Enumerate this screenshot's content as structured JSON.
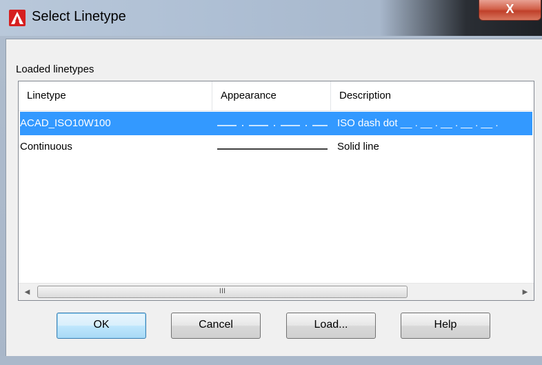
{
  "window": {
    "title": "Select Linetype",
    "close_label": "X",
    "app_icon": "autocad-icon",
    "accent_color": "#3399ff"
  },
  "group_label": "Loaded linetypes",
  "columns": [
    "Linetype",
    "Appearance",
    "Description"
  ],
  "rows": [
    {
      "linetype": "ACAD_ISO10W100",
      "appearance": "dash-dot",
      "description": "ISO dash dot __ . __ . __ . __ . __ .",
      "selected": true
    },
    {
      "linetype": "Continuous",
      "appearance": "solid",
      "description": "Solid line",
      "selected": false
    }
  ],
  "scrollbar": {
    "left": "◀",
    "right": "▶",
    "grip": "III"
  },
  "buttons": {
    "ok": "OK",
    "cancel": "Cancel",
    "load": "Load...",
    "help": "Help"
  }
}
